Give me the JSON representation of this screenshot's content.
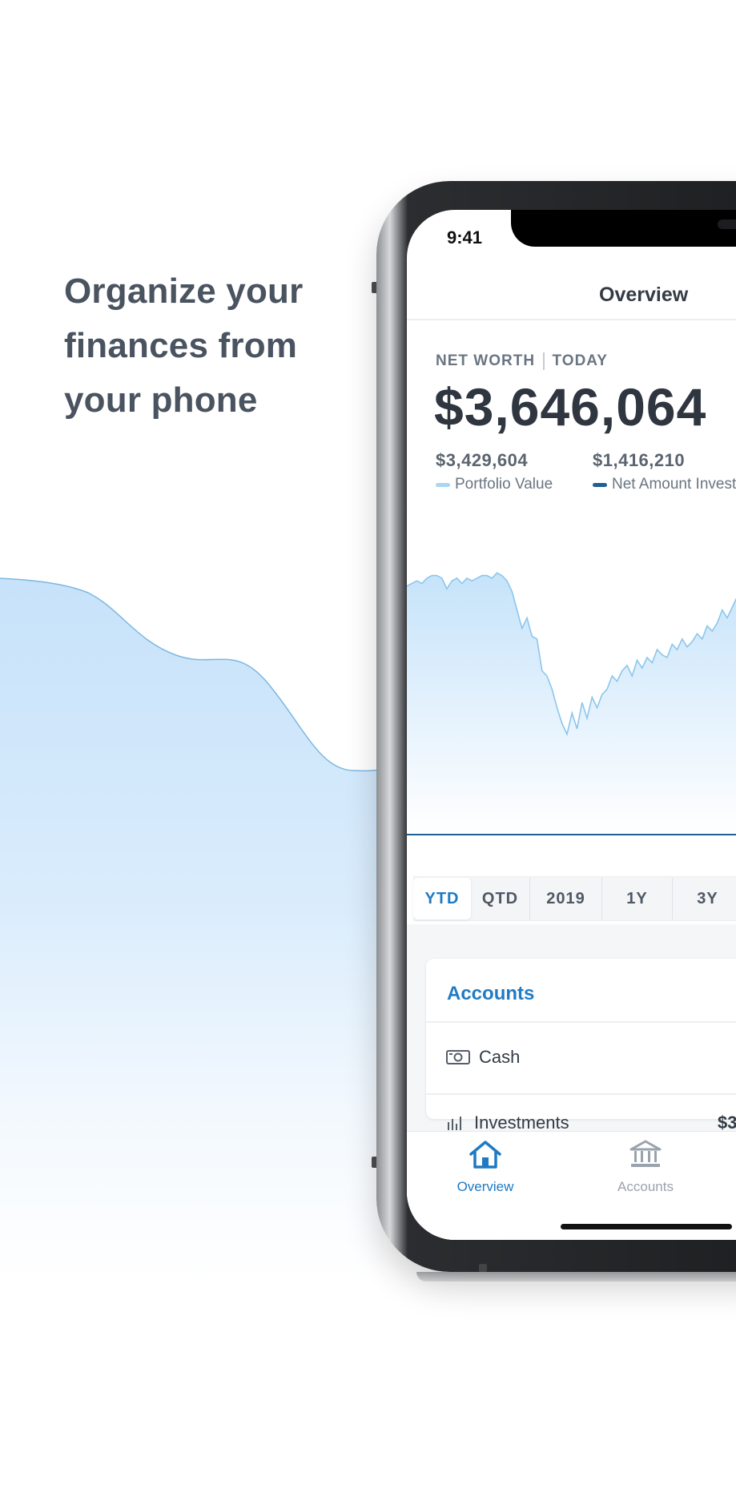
{
  "headline": [
    "Organize your",
    "finances from",
    "your phone"
  ],
  "status_bar": {
    "time": "9:41"
  },
  "nav": {
    "title": "Overview"
  },
  "net_worth": {
    "label": "NET WORTH",
    "period": "TODAY",
    "value": "$3,646,064"
  },
  "stats": [
    {
      "value": "$3,429,604",
      "label": "Portfolio Value",
      "color": "#a9d6f5"
    },
    {
      "value": "$1,416,210",
      "label": "Net Amount Invested",
      "color": "#1e5f94"
    }
  ],
  "ranges": [
    {
      "label": "YTD",
      "active": true
    },
    {
      "label": "QTD",
      "active": false
    },
    {
      "label": "2019",
      "active": false
    },
    {
      "label": "1Y",
      "active": false
    },
    {
      "label": "3Y",
      "active": false
    }
  ],
  "accounts": {
    "title": "Accounts",
    "rows": [
      {
        "label": "Cash",
        "icon": "cash-icon",
        "amount": ""
      },
      {
        "label": "Investments",
        "icon": "investments-icon",
        "amount": "$3"
      }
    ]
  },
  "tabbar": [
    {
      "label": "Overview",
      "icon": "home-icon",
      "active": true
    },
    {
      "label": "Accounts",
      "icon": "bank-icon",
      "active": false
    }
  ],
  "colors": {
    "accent": "#1d7ac3",
    "chart_fill": "#cfe7fb",
    "chart_line": "#8cc6ec",
    "invested_line": "#1e5f94",
    "background_wave": "#cfe6fb"
  },
  "chart_data": {
    "type": "area",
    "series": [
      {
        "name": "Portfolio Value",
        "values": [
          0.94,
          0.95,
          0.96,
          0.95,
          0.97,
          0.98,
          0.98,
          0.97,
          0.93,
          0.96,
          0.97,
          0.95,
          0.97,
          0.96,
          0.97,
          0.98,
          0.98,
          0.97,
          0.99,
          0.98,
          0.96,
          0.92,
          0.85,
          0.78,
          0.82,
          0.75,
          0.74,
          0.62,
          0.6,
          0.55,
          0.48,
          0.42,
          0.38,
          0.46,
          0.4,
          0.5,
          0.44,
          0.52,
          0.48,
          0.53,
          0.55,
          0.6,
          0.58,
          0.62,
          0.64,
          0.6,
          0.66,
          0.63,
          0.67,
          0.65,
          0.7,
          0.68,
          0.67,
          0.72,
          0.7,
          0.74,
          0.71,
          0.73,
          0.76,
          0.74,
          0.79,
          0.77,
          0.8,
          0.85,
          0.82,
          0.86,
          0.9,
          0.87,
          0.84,
          0.86,
          0.88,
          0.85,
          0.87,
          0.89,
          0.86,
          0.9,
          0.91,
          0.93,
          0.92,
          0.96,
          0.98
        ]
      },
      {
        "name": "Net Amount Invested",
        "values": [
          0.0
        ]
      }
    ]
  }
}
